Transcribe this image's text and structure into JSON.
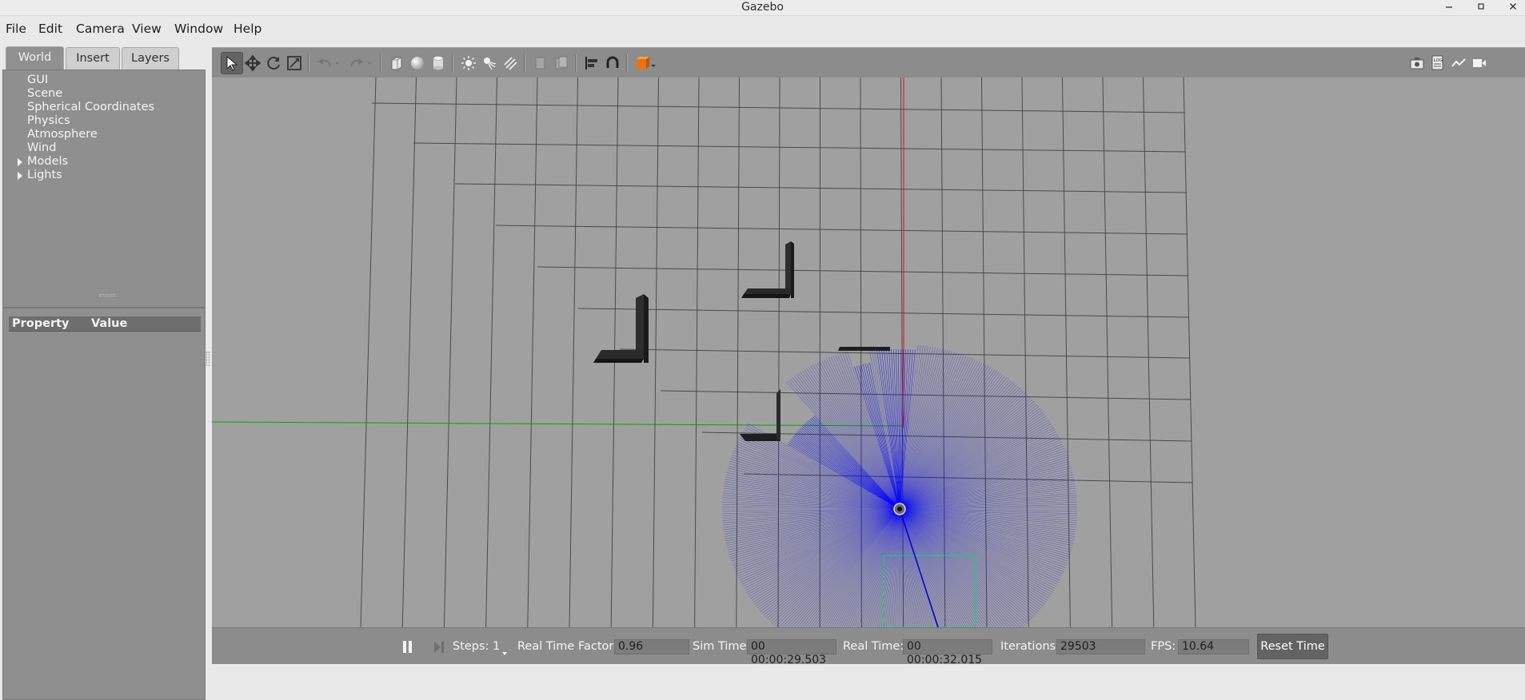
{
  "window": {
    "title": "Gazebo"
  },
  "menubar": {
    "items": [
      {
        "label": "File"
      },
      {
        "label": "Edit"
      },
      {
        "label": "Camera"
      },
      {
        "label": "View"
      },
      {
        "label": "Window"
      },
      {
        "label": "Help"
      }
    ]
  },
  "left_panel": {
    "tabs": [
      {
        "label": "World",
        "active": true
      },
      {
        "label": "Insert",
        "active": false
      },
      {
        "label": "Layers",
        "active": false
      }
    ],
    "tree": [
      {
        "label": "GUI",
        "expandable": false
      },
      {
        "label": "Scene",
        "expandable": false
      },
      {
        "label": "Spherical Coordinates",
        "expandable": false
      },
      {
        "label": "Physics",
        "expandable": false
      },
      {
        "label": "Atmosphere",
        "expandable": false
      },
      {
        "label": "Wind",
        "expandable": false
      },
      {
        "label": "Models",
        "expandable": true
      },
      {
        "label": "Lights",
        "expandable": true
      }
    ],
    "properties": {
      "col_property": "Property",
      "col_value": "Value"
    }
  },
  "toolbar": {
    "tools": [
      {
        "icon": "select-arrow-icon",
        "selected": true
      },
      {
        "icon": "translate-icon"
      },
      {
        "icon": "rotate-icon"
      },
      {
        "icon": "scale-icon"
      },
      {
        "icon": "undo-icon"
      },
      {
        "icon": "undo-dropdown-icon"
      },
      {
        "icon": "redo-icon"
      },
      {
        "icon": "redo-dropdown-icon"
      },
      {
        "icon": "box-shape-icon"
      },
      {
        "icon": "sphere-shape-icon"
      },
      {
        "icon": "cylinder-shape-icon"
      },
      {
        "icon": "point-light-icon"
      },
      {
        "icon": "spot-light-icon"
      },
      {
        "icon": "directional-light-icon"
      },
      {
        "icon": "copy-icon"
      },
      {
        "icon": "paste-icon"
      },
      {
        "icon": "align-icon"
      },
      {
        "icon": "snap-magnet-icon"
      },
      {
        "icon": "change-view-icon"
      }
    ],
    "right_tools": [
      {
        "icon": "screenshot-camera-icon"
      },
      {
        "icon": "log-icon"
      },
      {
        "icon": "plot-icon"
      },
      {
        "icon": "video-record-icon"
      }
    ]
  },
  "colors": {
    "viewport_bg": "#a0a0a0",
    "laser": "#0000ff",
    "x_axis": "#00aa00",
    "y_axis": "#ff0000",
    "collision_box": "#00dd66"
  },
  "status": {
    "steps_label": "Steps:",
    "steps_value": "1",
    "rtf_label": "Real Time Factor:",
    "rtf_value": "0.96",
    "sim_time_label": "Sim Time:",
    "sim_time_value": "00 00:00:29.503",
    "real_time_label": "Real Time:",
    "real_time_value": "00 00:00:32.015",
    "iterations_label": "Iterations:",
    "iterations_value": "29503",
    "fps_label": "FPS:",
    "fps_value": "10.64",
    "reset_label": "Reset Time"
  }
}
